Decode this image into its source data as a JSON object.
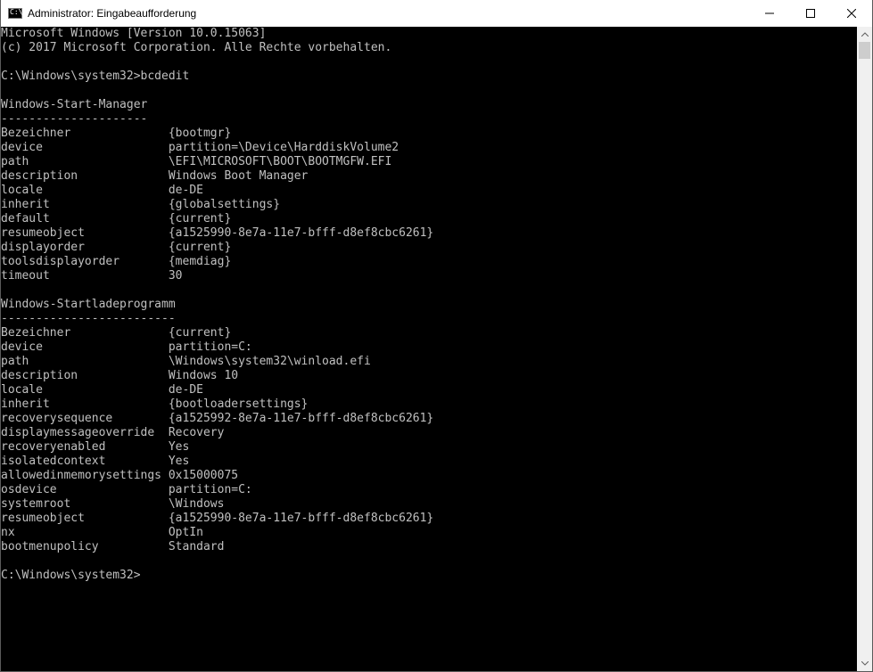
{
  "window": {
    "title": "Administrator: Eingabeaufforderung",
    "icon": "cmd-icon",
    "controls": {
      "minimize": "minimize-icon",
      "maximize": "maximize-icon",
      "close": "close-icon"
    }
  },
  "console": {
    "lines": [
      "Microsoft Windows [Version 10.0.15063]",
      "(c) 2017 Microsoft Corporation. Alle Rechte vorbehalten.",
      "",
      "C:\\Windows\\system32>bcdedit",
      "",
      "Windows-Start-Manager",
      "---------------------",
      "Bezeichner              {bootmgr}",
      "device                  partition=\\Device\\HarddiskVolume2",
      "path                    \\EFI\\MICROSOFT\\BOOT\\BOOTMGFW.EFI",
      "description             Windows Boot Manager",
      "locale                  de-DE",
      "inherit                 {globalsettings}",
      "default                 {current}",
      "resumeobject            {a1525990-8e7a-11e7-bfff-d8ef8cbc6261}",
      "displayorder            {current}",
      "toolsdisplayorder       {memdiag}",
      "timeout                 30",
      "",
      "Windows-Startladeprogramm",
      "-------------------------",
      "Bezeichner              {current}",
      "device                  partition=C:",
      "path                    \\Windows\\system32\\winload.efi",
      "description             Windows 10",
      "locale                  de-DE",
      "inherit                 {bootloadersettings}",
      "recoverysequence        {a1525992-8e7a-11e7-bfff-d8ef8cbc6261}",
      "displaymessageoverride  Recovery",
      "recoveryenabled         Yes",
      "isolatedcontext         Yes",
      "allowedinmemorysettings 0x15000075",
      "osdevice                partition=C:",
      "systemroot              \\Windows",
      "resumeobject            {a1525990-8e7a-11e7-bfff-d8ef8cbc6261}",
      "nx                      OptIn",
      "bootmenupolicy          Standard",
      "",
      "C:\\Windows\\system32>"
    ]
  },
  "colors": {
    "console_background": "#000000",
    "console_text": "#c0c0c0",
    "titlebar_background": "#ffffff"
  }
}
